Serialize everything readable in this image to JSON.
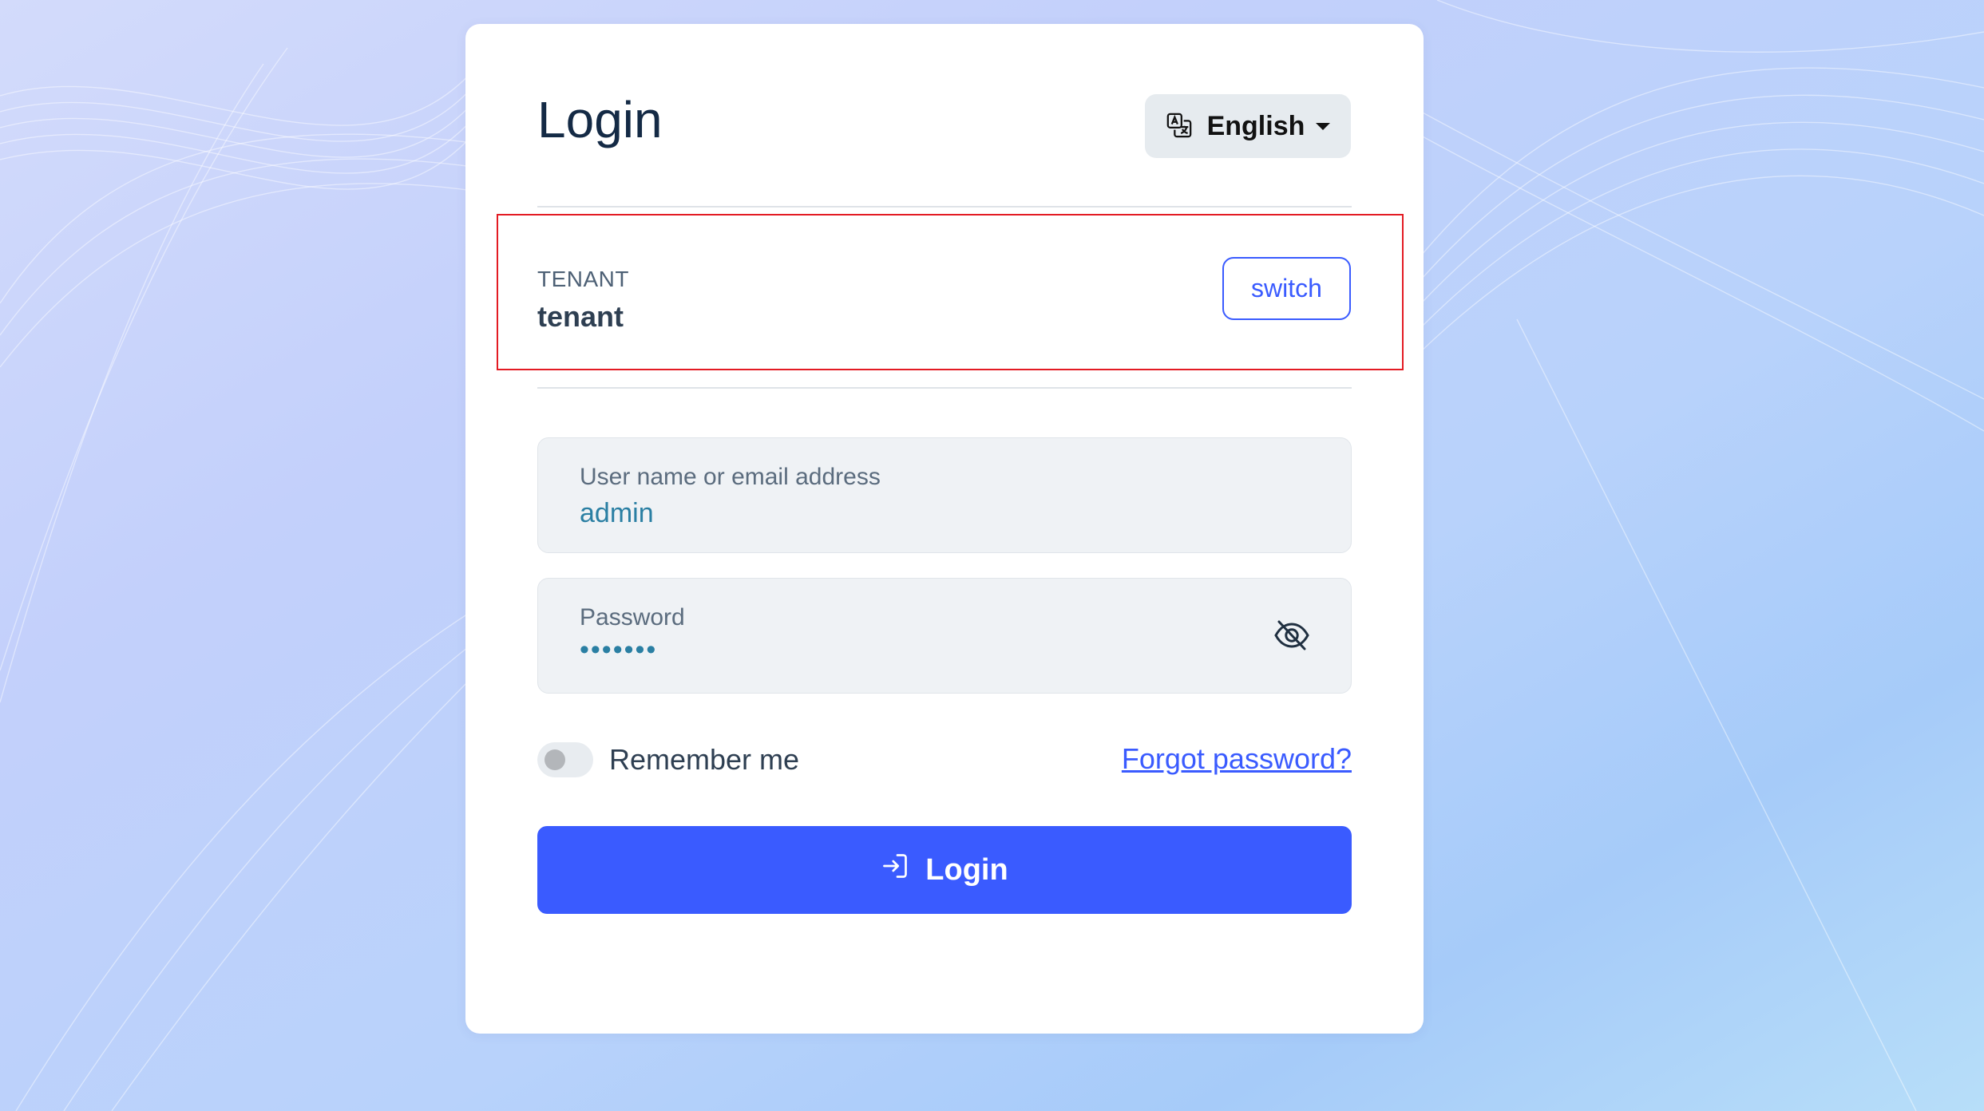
{
  "colors": {
    "accent": "#3a5bff",
    "highlight_border": "#e31b23",
    "title": "#142a45",
    "field_bg": "#eff2f5",
    "field_value": "#2a7fa3"
  },
  "header": {
    "title": "Login",
    "language": {
      "label": "English",
      "icon": "translate-icon",
      "caret_icon": "chevron-down-icon"
    }
  },
  "tenant": {
    "caption": "TENANT",
    "name": "tenant",
    "switch_label": "switch"
  },
  "form": {
    "username": {
      "label": "User name or email address",
      "value": "admin"
    },
    "password": {
      "label": "Password",
      "value": "•••••••",
      "visibility_icon": "eye-slash-icon"
    },
    "remember_me": {
      "label": "Remember me",
      "checked": false
    },
    "forgot_password_label": "Forgot password?",
    "submit": {
      "label": "Login",
      "icon": "sign-in-icon"
    }
  }
}
